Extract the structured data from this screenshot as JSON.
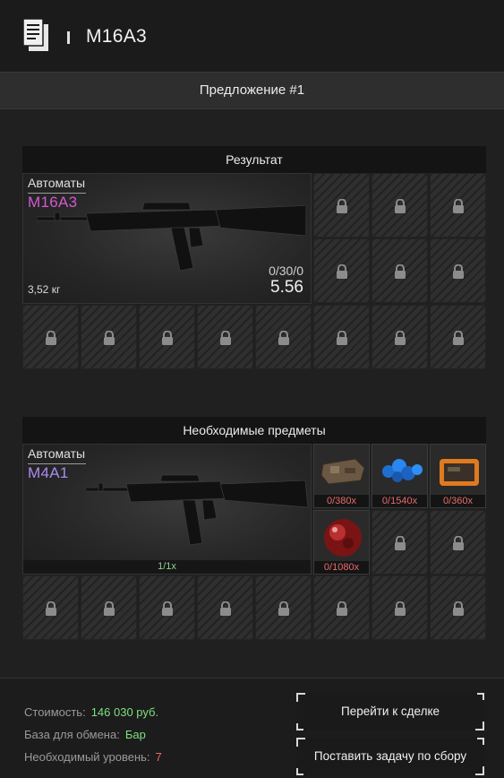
{
  "header": {
    "title": "M16A3",
    "icon": "document-icon"
  },
  "offer": {
    "label": "Предложение #1"
  },
  "result": {
    "heading": "Результат",
    "item": {
      "category": "Автоматы",
      "name": "M16A3",
      "name_color": "#d15ad1",
      "weight": "3,52 кг",
      "ammo": "0/30/0",
      "caliber": "5.56"
    }
  },
  "required": {
    "heading": "Необходимые предметы",
    "item": {
      "category": "Автоматы",
      "name": "M4A1",
      "name_color": "#a98cf0",
      "quantity": "1/1x"
    },
    "parts": [
      {
        "count": "0/380x",
        "icon": "scrap-metal-icon"
      },
      {
        "count": "0/1540x",
        "icon": "blue-crystals-icon"
      },
      {
        "count": "0/360x",
        "icon": "electronic-board-icon"
      },
      {
        "count": "0/1080x",
        "icon": "red-sphere-icon"
      }
    ]
  },
  "footer": {
    "cost_label": "Стоимость:",
    "cost_value": "146 030 руб.",
    "base_label": "База для обмена:",
    "base_value": "Бар",
    "level_label": "Необходимый уровень:",
    "level_value": "7",
    "deal_button": "Перейти к сделке",
    "task_button": "Поставить задачу по сбору"
  },
  "colors": {
    "cost": "#7de07d",
    "base": "#7de07d",
    "level": "#e86b6b"
  }
}
